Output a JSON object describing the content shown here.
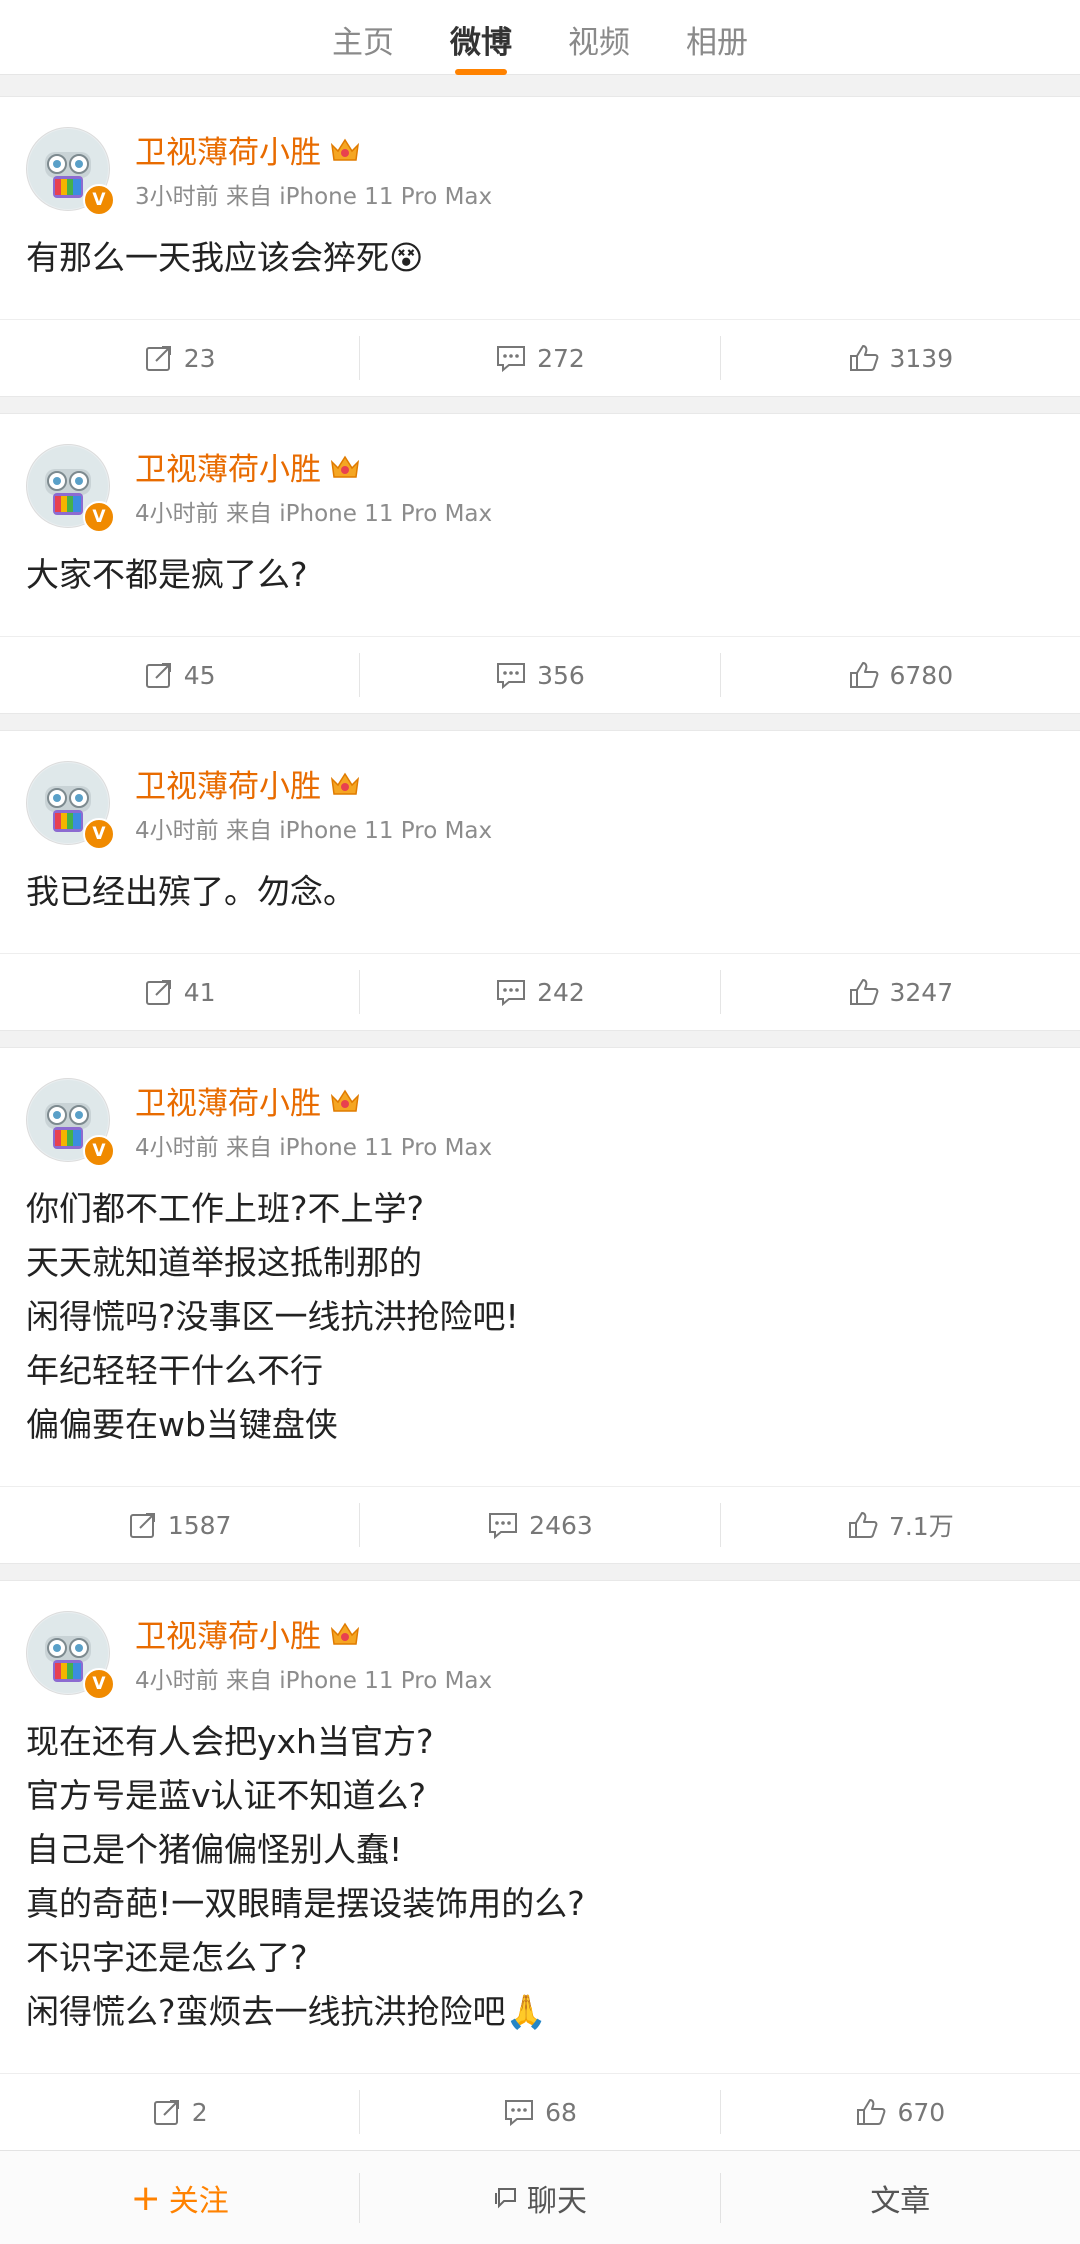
{
  "tabs": [
    {
      "label": "主页",
      "active": false
    },
    {
      "label": "微博",
      "active": true
    },
    {
      "label": "视频",
      "active": false
    },
    {
      "label": "相册",
      "active": false
    }
  ],
  "accent_color": "#ff8200",
  "posts": [
    {
      "author": "卫视薄荷小胜",
      "meta": "3小时前 来自 iPhone 11 Pro Max",
      "lines": [
        "有那么一天我应该会猝死😵"
      ],
      "repost": "23",
      "comment": "272",
      "like": "3139"
    },
    {
      "author": "卫视薄荷小胜",
      "meta": "4小时前 来自 iPhone 11 Pro Max",
      "lines": [
        "大家不都是疯了么?"
      ],
      "repost": "45",
      "comment": "356",
      "like": "6780"
    },
    {
      "author": "卫视薄荷小胜",
      "meta": "4小时前 来自 iPhone 11 Pro Max",
      "lines": [
        "我已经出殡了。勿念。"
      ],
      "repost": "41",
      "comment": "242",
      "like": "3247"
    },
    {
      "author": "卫视薄荷小胜",
      "meta": "4小时前 来自 iPhone 11 Pro Max",
      "lines": [
        "你们都不工作上班?不上学?",
        "天天就知道举报这抵制那的",
        "闲得慌吗?没事区一线抗洪抢险吧!",
        "年纪轻轻干什么不行",
        "偏偏要在wb当键盘侠"
      ],
      "repost": "1587",
      "comment": "2463",
      "like": "7.1万"
    },
    {
      "author": "卫视薄荷小胜",
      "meta": "4小时前 来自 iPhone 11 Pro Max",
      "lines": [
        "现在还有人会把yxh当官方?",
        "官方号是蓝v认证不知道么?",
        "自己是个猪偏偏怪别人蠢!",
        "真的奇葩!一双眼睛是摆设装饰用的么?",
        "不识字还是怎么了?",
        "闲得慌么?蛮烦去一线抗洪抢险吧🙏"
      ],
      "repost": "2",
      "comment": "68",
      "like": "670"
    }
  ],
  "verified_badge": "V",
  "bottom_bar": {
    "follow_label": "关注",
    "follow_prefix": "+",
    "chat_label": "聊天",
    "article_label": "文章"
  }
}
